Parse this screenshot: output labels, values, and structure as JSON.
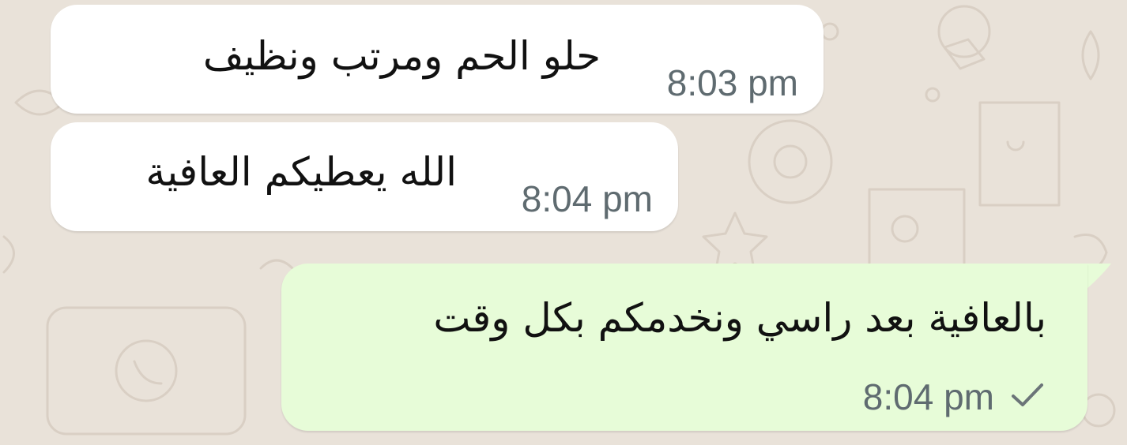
{
  "chat": {
    "messages": [
      {
        "direction": "incoming",
        "text": "حلو الحم ومرتب ونظيف",
        "time": "8:03 pm"
      },
      {
        "direction": "incoming",
        "text": "الله يعطيكم العافية",
        "time": "8:04 pm"
      },
      {
        "direction": "outgoing",
        "text": "بالعافية بعد راسي ونخدمكم بكل وقت",
        "time": "8:04 pm",
        "status": "sent",
        "status_icon": "single-check-icon"
      }
    ]
  },
  "colors": {
    "wallpaper": "#e9e2d9",
    "incoming_bubble": "#ffffff",
    "outgoing_bubble": "#e7fcd8",
    "message_text": "#111111",
    "timestamp_text": "#5f6b70",
    "tick": "#6b7478"
  }
}
